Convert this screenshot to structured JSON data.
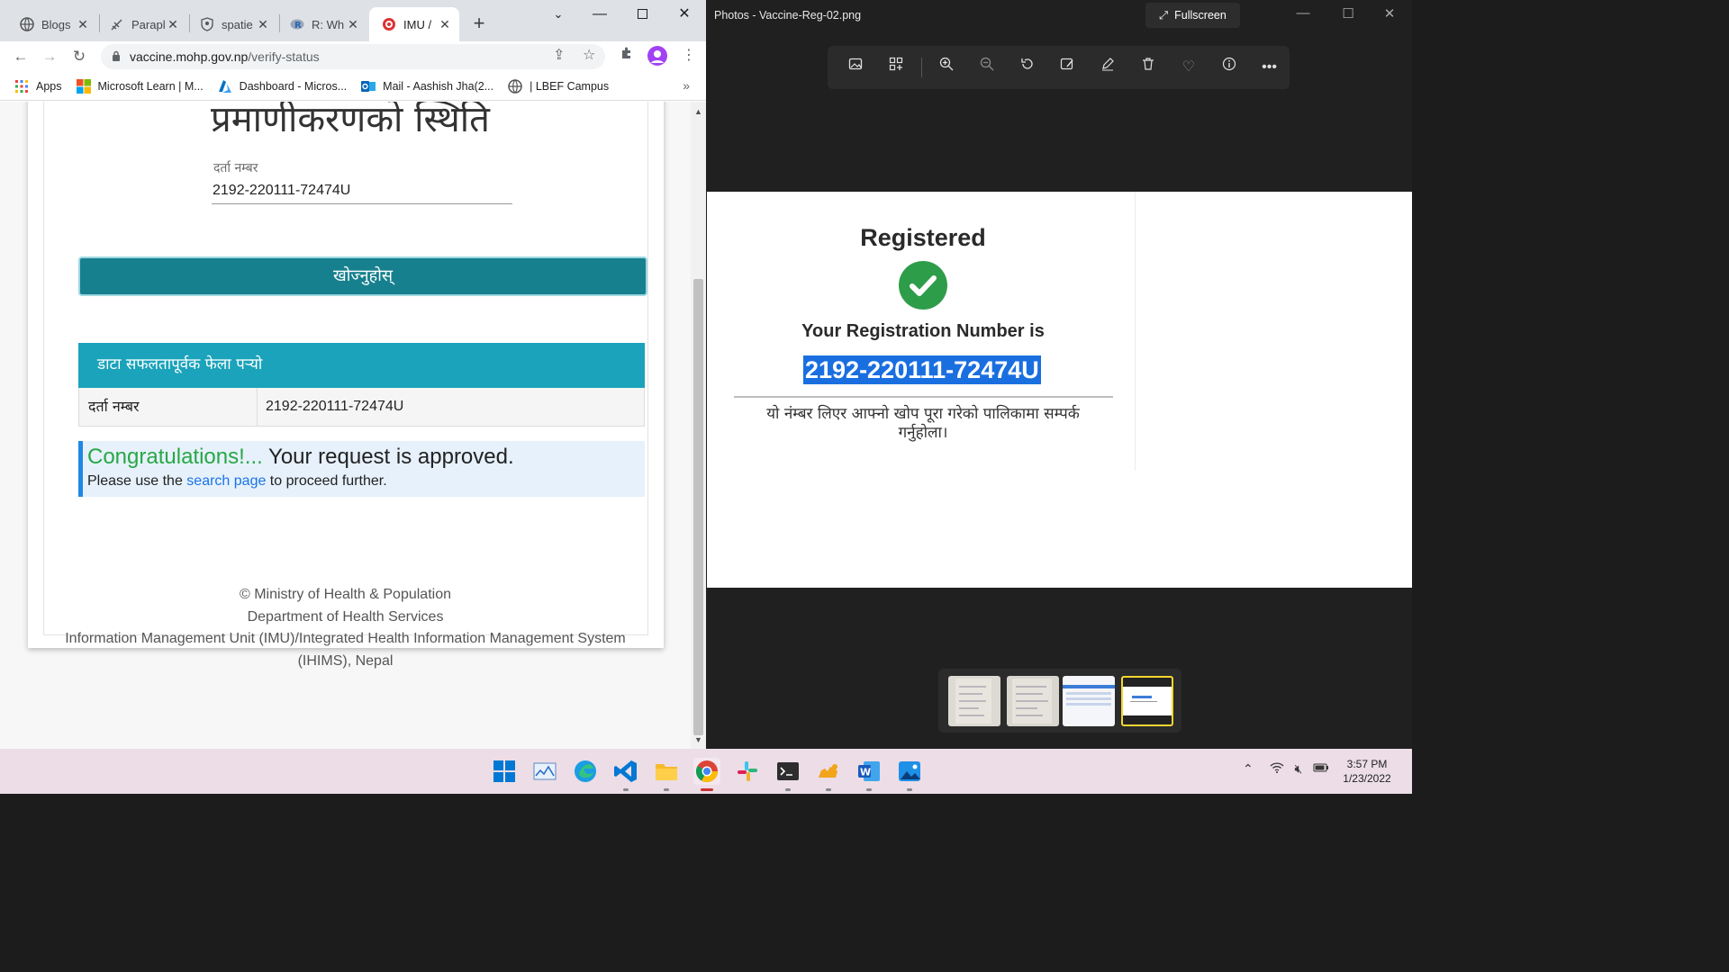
{
  "chrome": {
    "tabs": [
      {
        "label": "Blogs",
        "icon": "globe-icon"
      },
      {
        "label": "Parapl",
        "icon": "feather-icon"
      },
      {
        "label": "spatie",
        "icon": "shield-icon"
      },
      {
        "label": "R: Wh",
        "icon": "r-icon"
      },
      {
        "label": "IMU /",
        "icon": "imu-icon"
      }
    ],
    "url_host": "vaccine.mohp.gov.np",
    "url_path": "/verify-status",
    "bookmarks": [
      {
        "label": "Apps",
        "icon": "apps-grid-icon"
      },
      {
        "label": "Microsoft Learn | M...",
        "icon": "microsoft-icon"
      },
      {
        "label": "Dashboard - Micros...",
        "icon": "azure-icon"
      },
      {
        "label": "Mail - Aashish Jha(2...",
        "icon": "outlook-icon"
      },
      {
        "label": "| LBEF Campus",
        "icon": "globe-icon"
      }
    ],
    "bookmarks_more": "»"
  },
  "page": {
    "heading": "प्रमाणीकरणको स्थिति",
    "reg_label": "दर्ता नम्बर",
    "reg_value": "2192-220111-72474U",
    "search_button": "खोज्नुहोस्",
    "result_header": "डाटा सफलतापूर्वक फेला पर्‍यो",
    "result_key": "दर्ता नम्बर",
    "result_value": "2192-220111-72474U",
    "alert_congrats": "Congratulations!...",
    "alert_approved": " Your request is approved.",
    "alert_pre": "Please use the ",
    "alert_link": "search page",
    "alert_post": " to proceed further.",
    "footer": [
      "© Ministry of Health & Population",
      "Department of Health Services",
      "Information Management Unit (IMU)/Integrated Health Information Management System",
      "(IHIMS), Nepal"
    ]
  },
  "photos": {
    "title": "Photos - Vaccine-Reg-02.png",
    "fullscreen_label": "Fullscreen",
    "image": {
      "registered": "Registered",
      "regnum_label": "Your Registration Number is",
      "regnum": "2192-220111-72474U",
      "note": "यो नंम्बर लिएर आफ्नो खोप पूरा गरेको पालिकामा सम्पर्क गर्नुहोला।"
    }
  },
  "taskbar": {
    "time": "3:57 PM",
    "date": "1/23/2022",
    "apps": [
      "windows-start",
      "task-manager",
      "edge",
      "vscode",
      "file-explorer",
      "chrome",
      "slack",
      "terminal",
      "camel",
      "word",
      "photos"
    ]
  },
  "colors": {
    "accent_teal": "#17808e",
    "panel_header": "#1aa3ba",
    "success_green": "#28a745",
    "link_blue": "#1a73e8",
    "highlight_blue": "#1a6fe0"
  }
}
